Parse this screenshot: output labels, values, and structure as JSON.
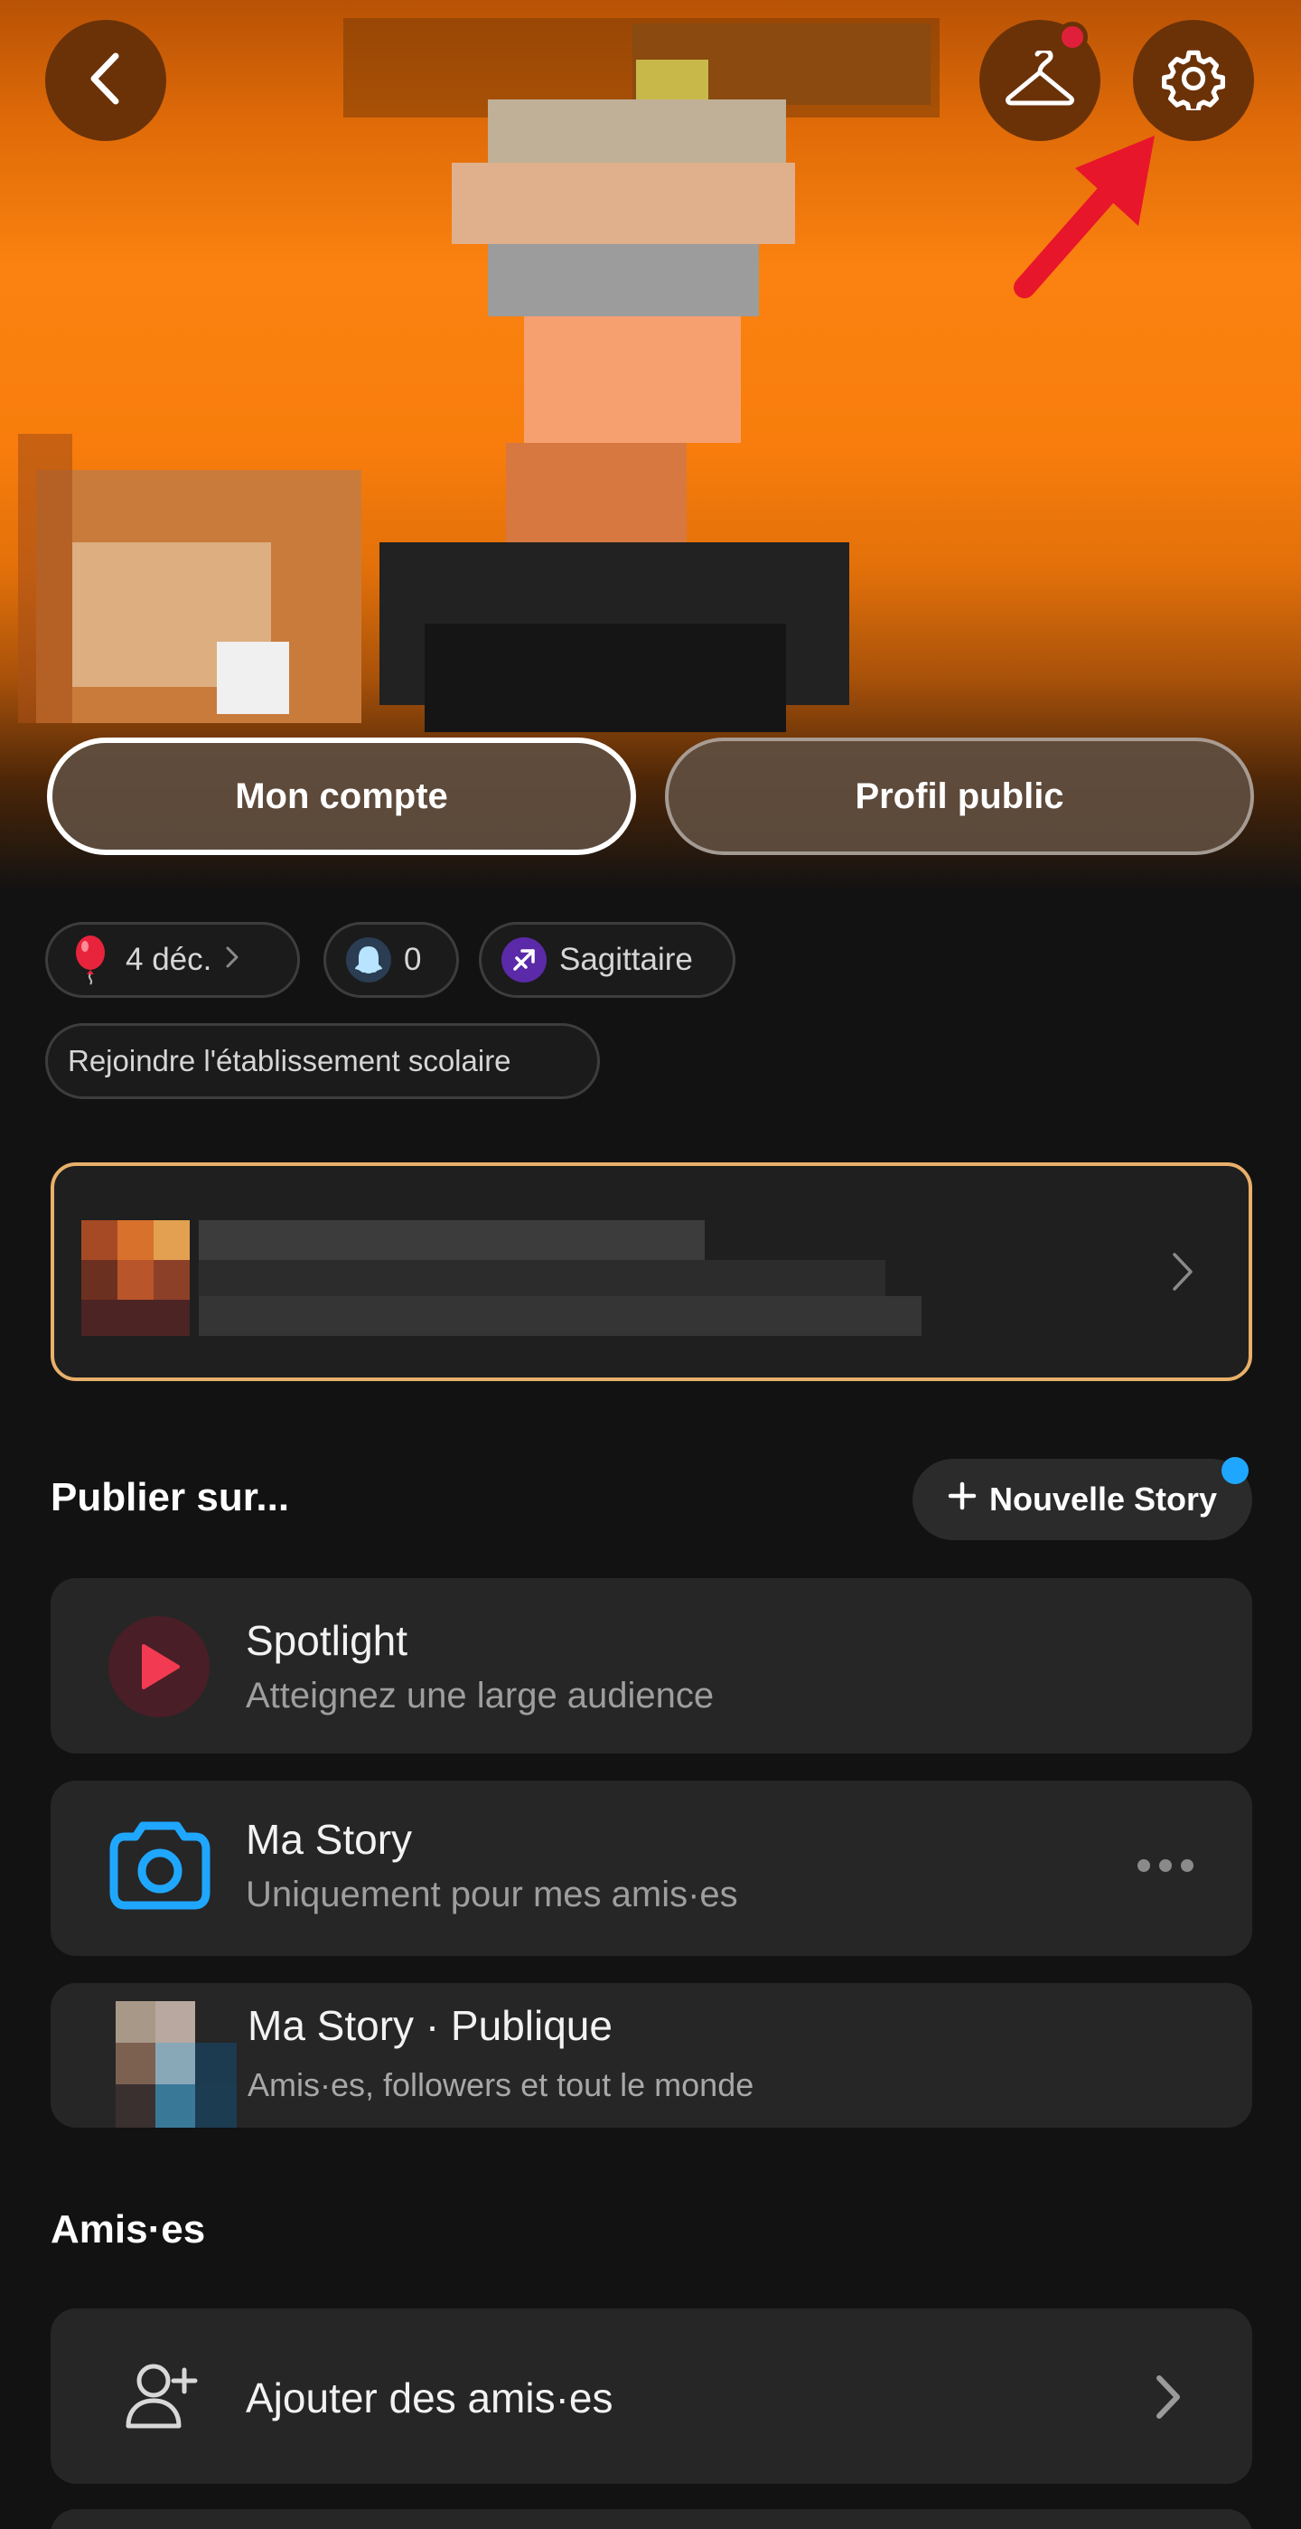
{
  "header": {
    "tabs": {
      "my_account": "Mon compte",
      "public_profile": "Profil public"
    },
    "icons": {
      "back": "chevron-left-icon",
      "outfit": "hanger-icon",
      "settings": "gear-icon",
      "annotation": "red-arrow-icon"
    }
  },
  "badges": {
    "birthday": "4 déc.",
    "snapscore": "0",
    "zodiac": "Sagittaire",
    "school": "Rejoindre l'établissement scolaire"
  },
  "publish": {
    "title": "Publier sur...",
    "new_story": "Nouvelle Story",
    "items": [
      {
        "title": "Spotlight",
        "subtitle": "Atteignez une large audience",
        "icon": "play-icon"
      },
      {
        "title": "Ma Story",
        "subtitle": "Uniquement pour mes amis·es",
        "icon": "camera-icon"
      },
      {
        "title": "Ma Story · Publique",
        "subtitle": "Amis·es, followers et tout le monde",
        "icon": "avatar"
      }
    ]
  },
  "friends": {
    "title": "Amis·es",
    "add": "Ajouter des amis·es"
  },
  "colors": {
    "accent": "#fb8210",
    "background": "#121212",
    "card": "#262626",
    "notif": "#e0203a",
    "blue": "#1fa7ff"
  }
}
